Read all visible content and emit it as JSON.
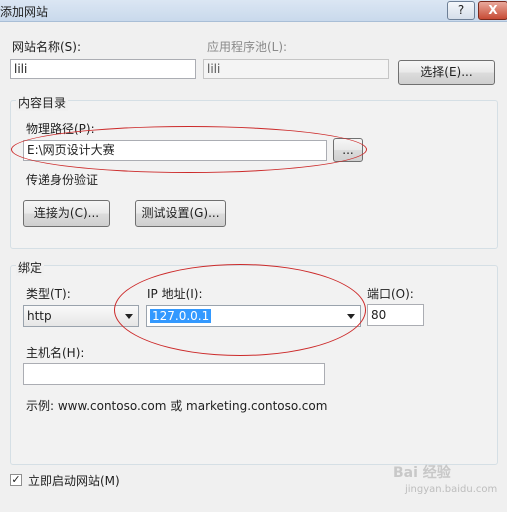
{
  "window": {
    "title": "添加网站",
    "help_label": "?",
    "close_label": "X"
  },
  "site": {
    "name_label": "网站名称(S):",
    "name_value": "lili",
    "pool_label": "应用程序池(L):",
    "pool_value": "lili",
    "select_button": "选择(E)..."
  },
  "content": {
    "group_label": "内容目录",
    "path_label": "物理路径(P):",
    "path_value": "E:\\网页设计大赛",
    "browse_button": "...",
    "auth_label": "传递身份验证",
    "connect_button": "连接为(C)...",
    "test_button": "测试设置(G)..."
  },
  "binding": {
    "group_label": "绑定",
    "type_label": "类型(T):",
    "type_value": "http",
    "ip_label": "IP 地址(I):",
    "ip_value": "127.0.0.1",
    "port_label": "端口(O):",
    "port_value": "80",
    "host_label": "主机名(H):",
    "host_value": "",
    "example_text": "示例: www.contoso.com 或 marketing.contoso.com"
  },
  "start": {
    "checked": true,
    "label": "立即启动网站(M)"
  },
  "watermark": {
    "text": "Bai 经验",
    "url": "jingyan.baidu.com"
  },
  "colors": {
    "annotation": "#cc2a2a",
    "selection": "#3399ff"
  }
}
